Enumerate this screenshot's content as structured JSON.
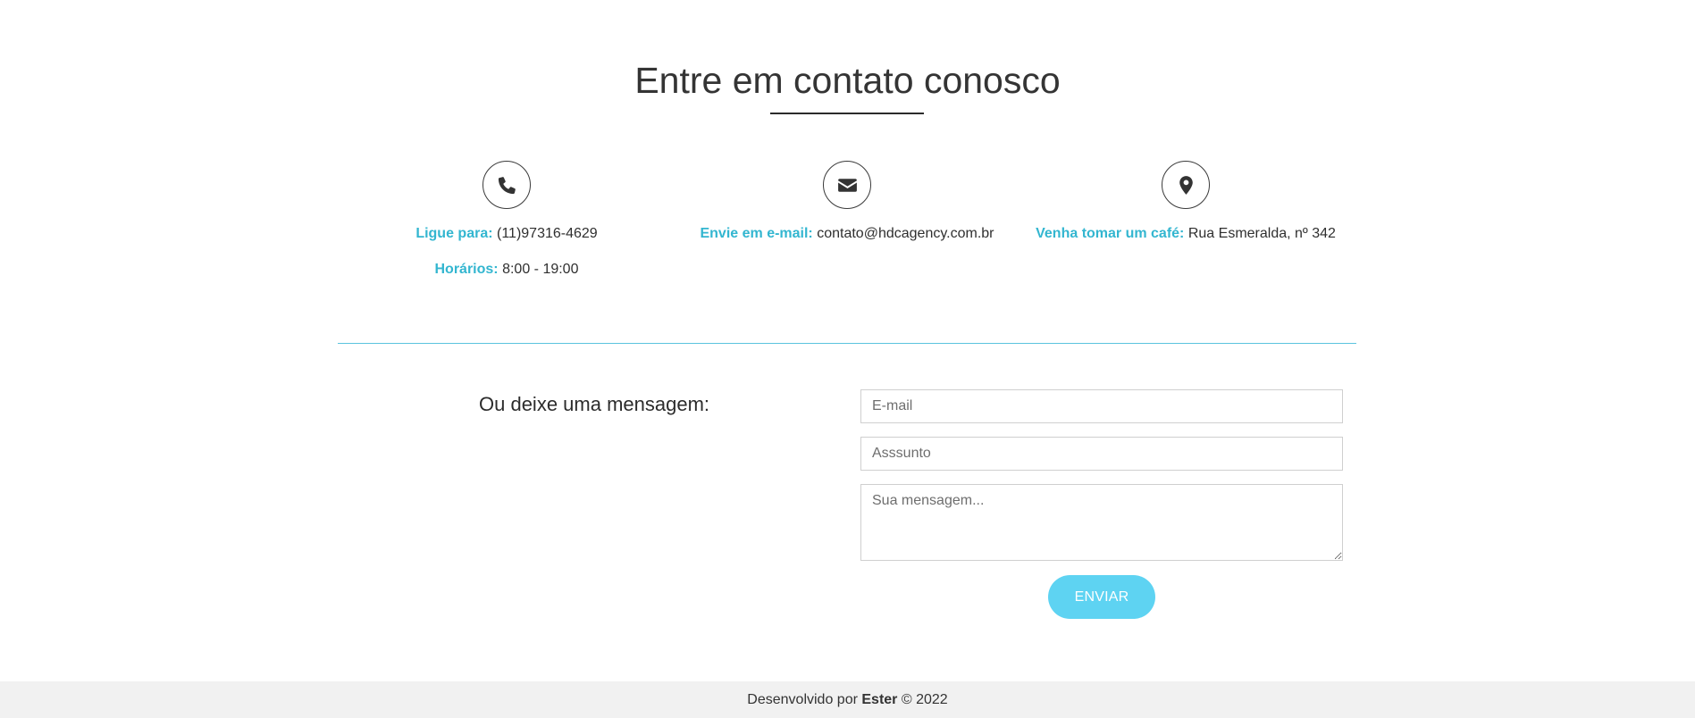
{
  "section": {
    "title": "Entre em contato conosco"
  },
  "contact_info": {
    "phone": {
      "icon": "phone-icon",
      "label": "Ligue para:",
      "value": "(11)97316-4629",
      "hours_label": "Horários:",
      "hours_value": "8:00 - 19:00"
    },
    "email": {
      "icon": "envelope-icon",
      "label": "Envie em e-mail:",
      "value": "contato@hdcagency.com.br"
    },
    "address": {
      "icon": "map-marker-icon",
      "label": "Venha tomar um café:",
      "value": "Rua Esmeralda, nº 342"
    }
  },
  "form": {
    "prompt": "Ou deixe uma mensagem:",
    "email_placeholder": "E-mail",
    "subject_placeholder": "Asssunto",
    "message_placeholder": "Sua mensagem...",
    "submit_label": "ENVIAR"
  },
  "footer": {
    "prefix": "Desenvolvido por",
    "author": "Ester",
    "suffix": "© 2022"
  },
  "colors": {
    "accent": "#33b6d0",
    "button": "#5ed3f2",
    "divider": "#5bc4de",
    "footer_bg": "#f1f1f1"
  }
}
